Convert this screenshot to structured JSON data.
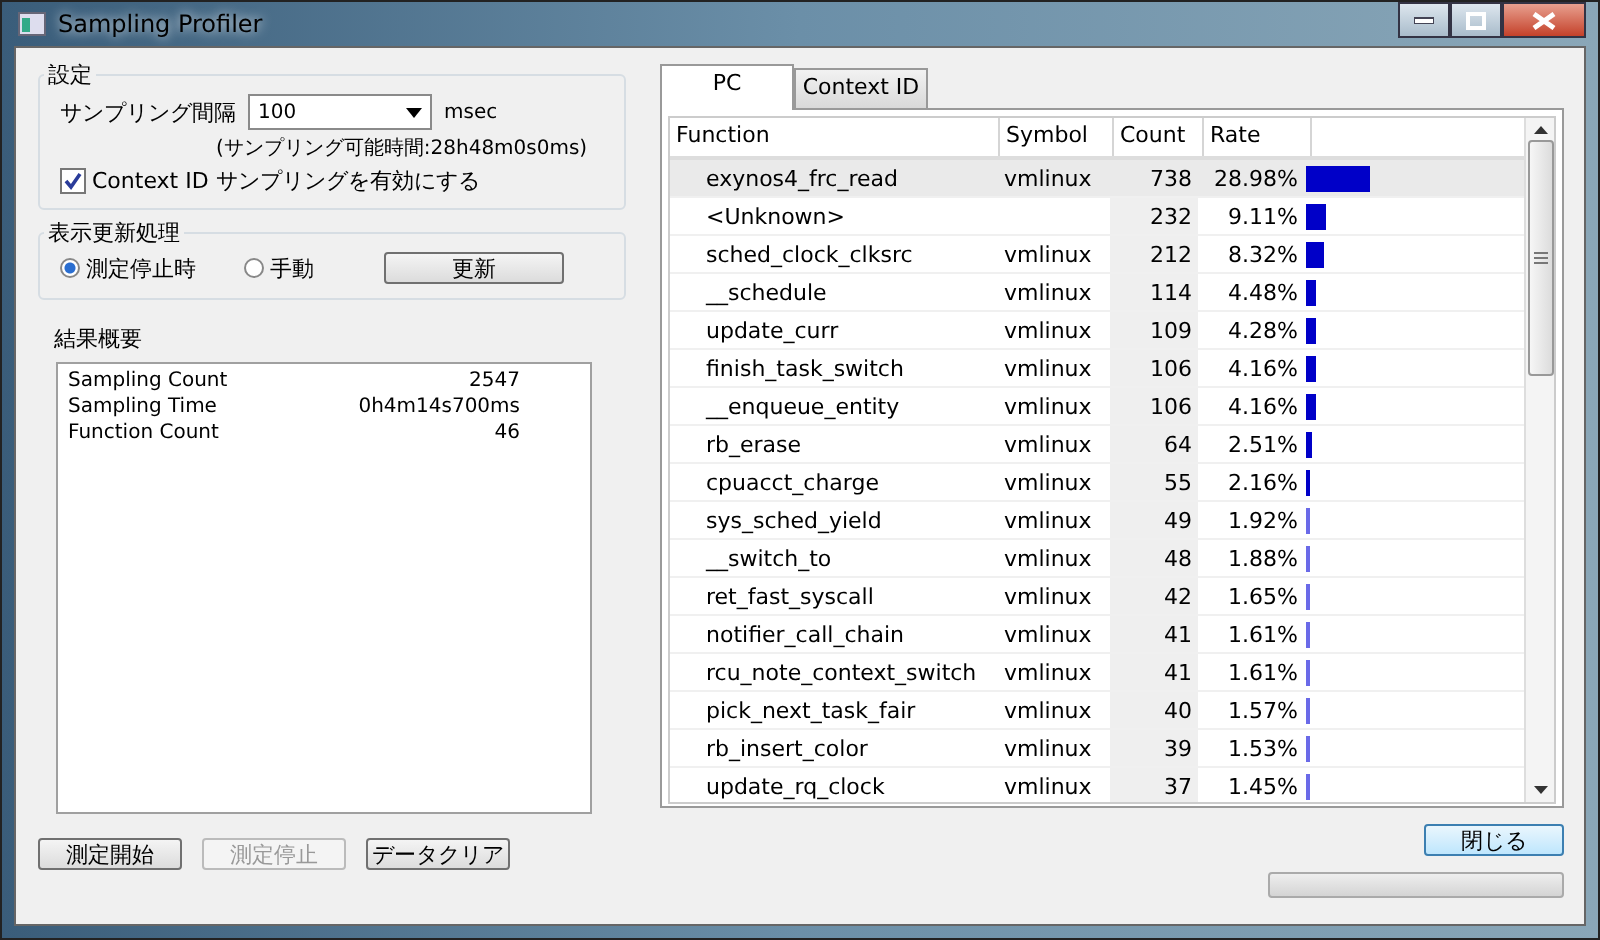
{
  "window": {
    "title": "Sampling Profiler"
  },
  "settings": {
    "title": "設定",
    "interval_label": "サンプリング間隔",
    "interval_value": "100",
    "interval_unit": "msec",
    "capacity_note": "(サンプリング可能時間:28h48m0s0ms)",
    "context_checkbox": {
      "label": "Context ID サンプリングを有効にする",
      "checked": true
    }
  },
  "refresh": {
    "title": "表示更新処理",
    "options": [
      {
        "label": "測定停止時",
        "selected": true
      },
      {
        "label": "手動",
        "selected": false
      }
    ],
    "button": "更新"
  },
  "summary": {
    "title": "結果概要",
    "rows": [
      {
        "label": "Sampling Count",
        "value": "2547"
      },
      {
        "label": "Sampling Time",
        "value": "0h4m14s700ms"
      },
      {
        "label": "Function Count",
        "value": "46"
      }
    ]
  },
  "buttons": [
    {
      "label": "測定開始",
      "disabled": false
    },
    {
      "label": "測定停止",
      "disabled": true
    },
    {
      "label": "データクリア",
      "disabled": false
    }
  ],
  "tabs": [
    {
      "label": "PC",
      "selected": true
    },
    {
      "label": "Context ID",
      "selected": false
    }
  ],
  "table": {
    "columns": [
      "Function",
      "Symbol",
      "Count",
      "Rate"
    ],
    "rows": [
      {
        "function": "exynos4_frc_read",
        "symbol": "vmlinux",
        "count": "738",
        "rate": "28.98%",
        "level": 0.2898,
        "selected": true
      },
      {
        "function": "<Unknown>",
        "symbol": "",
        "count": "232",
        "rate": "9.11%",
        "level": 0.0911,
        "selected": false
      },
      {
        "function": "sched_clock_clksrc",
        "symbol": "vmlinux",
        "count": "212",
        "rate": "8.32%",
        "level": 0.0832,
        "selected": false
      },
      {
        "function": "__schedule",
        "symbol": "vmlinux",
        "count": "114",
        "rate": "4.48%",
        "level": 0.0448,
        "selected": false
      },
      {
        "function": "update_curr",
        "symbol": "vmlinux",
        "count": "109",
        "rate": "4.28%",
        "level": 0.0428,
        "selected": false
      },
      {
        "function": "finish_task_switch",
        "symbol": "vmlinux",
        "count": "106",
        "rate": "4.16%",
        "level": 0.0416,
        "selected": false
      },
      {
        "function": "__enqueue_entity",
        "symbol": "vmlinux",
        "count": "106",
        "rate": "4.16%",
        "level": 0.0416,
        "selected": false
      },
      {
        "function": "rb_erase",
        "symbol": "vmlinux",
        "count": "64",
        "rate": "2.51%",
        "level": 0.0251,
        "selected": false
      },
      {
        "function": "cpuacct_charge",
        "symbol": "vmlinux",
        "count": "55",
        "rate": "2.16%",
        "level": 0.0216,
        "selected": false
      },
      {
        "function": "sys_sched_yield",
        "symbol": "vmlinux",
        "count": "49",
        "rate": "1.92%",
        "level": 0.0192,
        "selected": false
      },
      {
        "function": "__switch_to",
        "symbol": "vmlinux",
        "count": "48",
        "rate": "1.88%",
        "level": 0.0188,
        "selected": false
      },
      {
        "function": "ret_fast_syscall",
        "symbol": "vmlinux",
        "count": "42",
        "rate": "1.65%",
        "level": 0.0165,
        "selected": false
      },
      {
        "function": "notifier_call_chain",
        "symbol": "vmlinux",
        "count": "41",
        "rate": "1.61%",
        "level": 0.0161,
        "selected": false
      },
      {
        "function": "rcu_note_context_switch",
        "symbol": "vmlinux",
        "count": "41",
        "rate": "1.61%",
        "level": 0.0161,
        "selected": false
      },
      {
        "function": "pick_next_task_fair",
        "symbol": "vmlinux",
        "count": "40",
        "rate": "1.57%",
        "level": 0.0157,
        "selected": false
      },
      {
        "function": "rb_insert_color",
        "symbol": "vmlinux",
        "count": "39",
        "rate": "1.53%",
        "level": 0.0153,
        "selected": false
      },
      {
        "function": "update_rq_clock",
        "symbol": "vmlinux",
        "count": "37",
        "rate": "1.45%",
        "level": 0.0145,
        "selected": false
      }
    ]
  },
  "close_button": "閉じる",
  "progress": {
    "level": 0
  }
}
